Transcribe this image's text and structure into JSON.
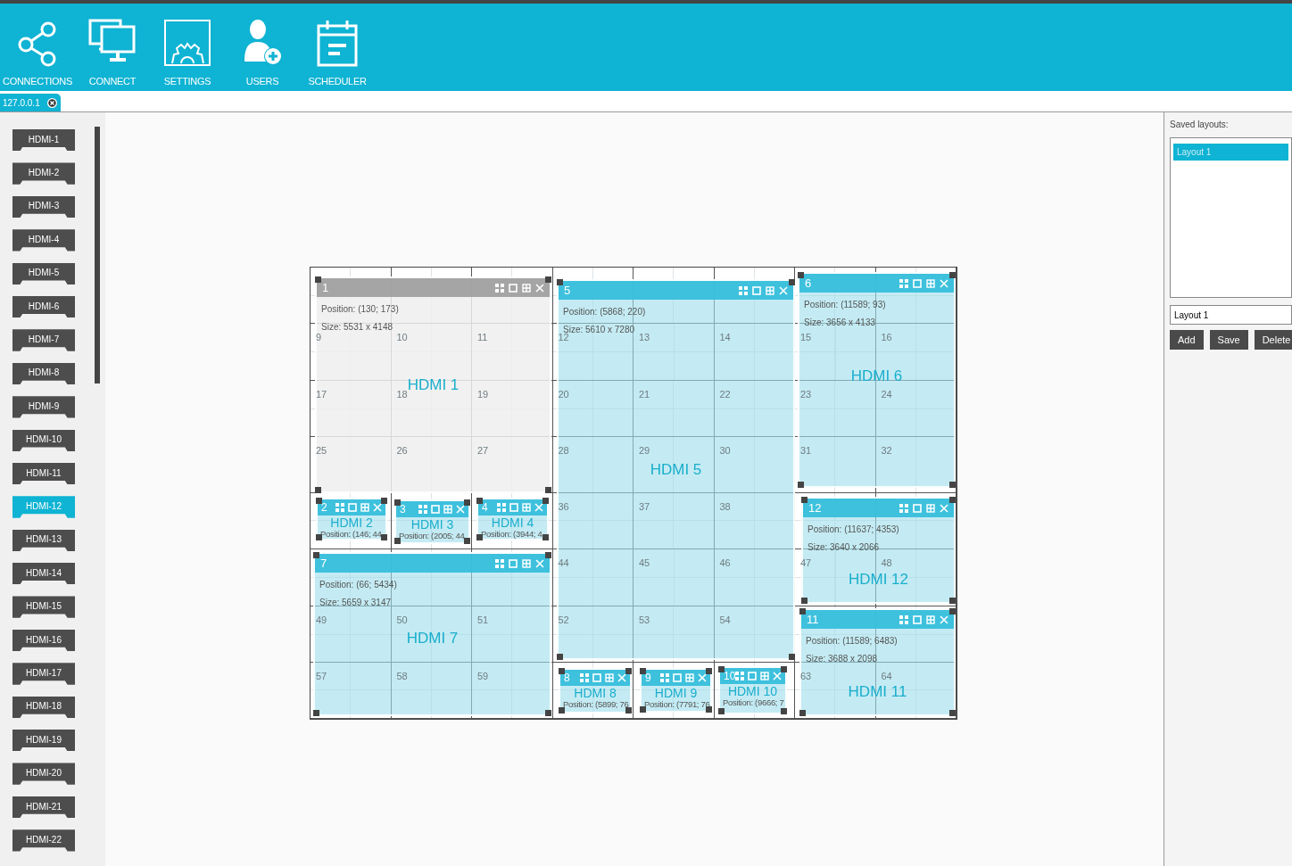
{
  "toolbar": [
    {
      "label": "CONNECTIONS"
    },
    {
      "label": "CONNECT"
    },
    {
      "label": "SETTINGS"
    },
    {
      "label": "USERS"
    },
    {
      "label": "SCHEDULER"
    }
  ],
  "tabs": [
    {
      "label": "127.0.0.1",
      "selected": true
    }
  ],
  "inputs": [
    {
      "label": "HDMI-1",
      "selected": false
    },
    {
      "label": "HDMI-2",
      "selected": false
    },
    {
      "label": "HDMI-3",
      "selected": false
    },
    {
      "label": "HDMI-4",
      "selected": false
    },
    {
      "label": "HDMI-5",
      "selected": false
    },
    {
      "label": "HDMI-6",
      "selected": false
    },
    {
      "label": "HDMI-7",
      "selected": false
    },
    {
      "label": "HDMI-8",
      "selected": false
    },
    {
      "label": "HDMI-9",
      "selected": false
    },
    {
      "label": "HDMI-10",
      "selected": false
    },
    {
      "label": "HDMI-11",
      "selected": false
    },
    {
      "label": "HDMI-12",
      "selected": true
    },
    {
      "label": "HDMI-13",
      "selected": false
    },
    {
      "label": "HDMI-14",
      "selected": false
    },
    {
      "label": "HDMI-15",
      "selected": false
    },
    {
      "label": "HDMI-16",
      "selected": false
    },
    {
      "label": "HDMI-17",
      "selected": false
    },
    {
      "label": "HDMI-18",
      "selected": false
    },
    {
      "label": "HDMI-19",
      "selected": false
    },
    {
      "label": "HDMI-20",
      "selected": false
    },
    {
      "label": "HDMI-21",
      "selected": false
    },
    {
      "label": "HDMI-22",
      "selected": false
    }
  ],
  "wall": {
    "grid_rows": [
      [
        {},
        {},
        {},
        {},
        {},
        {},
        {},
        {}
      ],
      [
        {
          "number": "9"
        },
        {
          "number": "10"
        },
        {
          "number": "11"
        },
        {
          "number": "12"
        },
        {
          "number": "13"
        },
        {
          "number": "14"
        },
        {
          "number": "15"
        },
        {
          "number": "16"
        }
      ],
      [
        {
          "number": "17"
        },
        {
          "number": "18"
        },
        {
          "number": "19"
        },
        {
          "number": "20"
        },
        {
          "number": "21"
        },
        {
          "number": "22"
        },
        {
          "number": "23"
        },
        {
          "number": "24"
        }
      ],
      [
        {
          "number": "25"
        },
        {
          "number": "26"
        },
        {
          "number": "27"
        },
        {
          "number": "28"
        },
        {
          "number": "29"
        },
        {
          "number": "30"
        },
        {
          "number": "31"
        },
        {
          "number": "32"
        }
      ],
      [
        {},
        {},
        {},
        {
          "number": "36"
        },
        {
          "number": "37"
        },
        {
          "number": "38"
        },
        {},
        {}
      ],
      [
        {},
        {},
        {},
        {
          "number": "44"
        },
        {
          "number": "45"
        },
        {
          "number": "46"
        },
        {
          "number": "47"
        },
        {
          "number": "48"
        }
      ],
      [
        {
          "number": "49"
        },
        {
          "number": "50"
        },
        {
          "number": "51"
        },
        {
          "number": "52"
        },
        {
          "number": "53"
        },
        {
          "number": "54"
        },
        {},
        {}
      ],
      [
        {
          "number": "57"
        },
        {
          "number": "58"
        },
        {
          "number": "59"
        },
        {},
        {},
        {},
        {
          "number": "63"
        },
        {
          "number": "64"
        }
      ]
    ],
    "windows": [
      {
        "kind": "large",
        "number": "1",
        "source": "HDMI 1",
        "position": "Position: (130; 173)",
        "size": "Size: 5531 x 4148",
        "selected": true
      },
      {
        "kind": "large",
        "number": "5",
        "source": "HDMI 5",
        "position": "Position: (5868; 220)",
        "size": "Size: 5610 x 7280",
        "selected": false
      },
      {
        "kind": "large",
        "number": "6",
        "source": "HDMI 6",
        "position": "Position: (11589; 93)",
        "size": "Size: 3656 x 4133",
        "selected": false
      },
      {
        "kind": "small",
        "number": "2",
        "source": "HDMI 2",
        "position": "Position: (146; 44",
        "selected": false
      },
      {
        "kind": "small",
        "number": "3",
        "source": "HDMI 3",
        "position": "Position: (2005; 44",
        "selected": false
      },
      {
        "kind": "small",
        "number": "4",
        "source": "HDMI 4",
        "position": "Position: (3944; 4",
        "selected": false
      },
      {
        "kind": "large",
        "number": "12",
        "source": "HDMI 12",
        "position": "Position: (11637; 4353)",
        "size": "Size: 3640 x 2066",
        "selected": false
      },
      {
        "kind": "large",
        "number": "7",
        "source": "HDMI 7",
        "position": "Position: (66; 5434)",
        "size": "Size: 5659 x 3147",
        "selected": false
      },
      {
        "kind": "small",
        "number": "8",
        "source": "HDMI 8",
        "position": "Position: (5899; 76",
        "selected": false
      },
      {
        "kind": "small",
        "number": "9",
        "source": "HDMI 9",
        "position": "Position: (7791; 76",
        "selected": false
      },
      {
        "kind": "small",
        "number": "10",
        "source": "HDMI 10",
        "position": "Position: (9666; 7",
        "selected": false
      },
      {
        "kind": "large",
        "number": "11",
        "source": "HDMI 11",
        "position": "Position: (11589; 6483)",
        "size": "Size: 3688 x 2098",
        "selected": false
      }
    ]
  },
  "layouts": {
    "title": "Saved layouts:",
    "items": [
      {
        "label": "Layout 1",
        "selected": true
      }
    ],
    "name_field": {
      "value": "Layout 1"
    },
    "buttons": [
      "Add",
      "Save",
      "Delete"
    ]
  }
}
